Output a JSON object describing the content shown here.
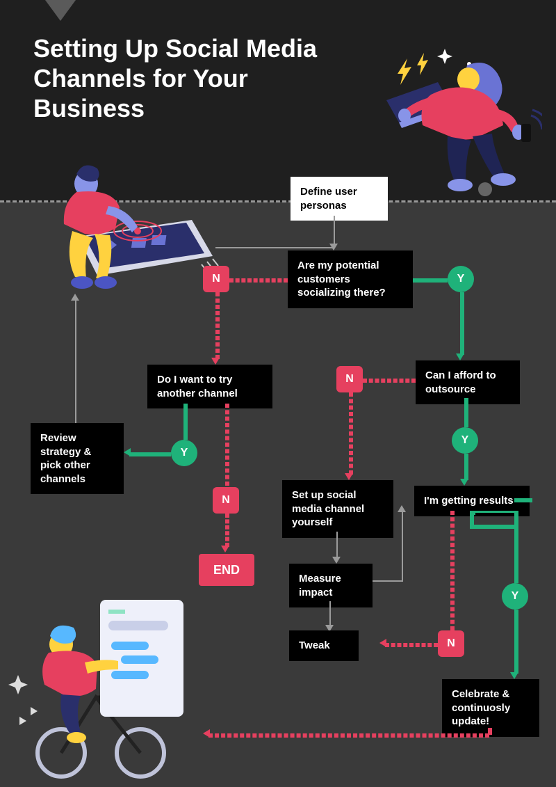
{
  "title": "Setting Up Social Media Channels for Your Business",
  "nodes": {
    "define": "Define user personas",
    "q_socializing": "Are my potential customers socializing there?",
    "q_another": "Do I want to try another channel",
    "q_outsource": "Can I afford to outsource",
    "review": "Review strategy & pick other channels",
    "setup": "Set up social media channel yourself",
    "results": "I'm getting results",
    "measure": "Measure impact",
    "tweak": "Tweak",
    "celebrate": "Celebrate & continuosly update!"
  },
  "labels": {
    "y": "Y",
    "n": "N",
    "end": "END"
  },
  "colors": {
    "yes": "#1fb27a",
    "no": "#e6405f",
    "bg_dark": "#1f1f1f",
    "bg": "#3a3a3a"
  }
}
